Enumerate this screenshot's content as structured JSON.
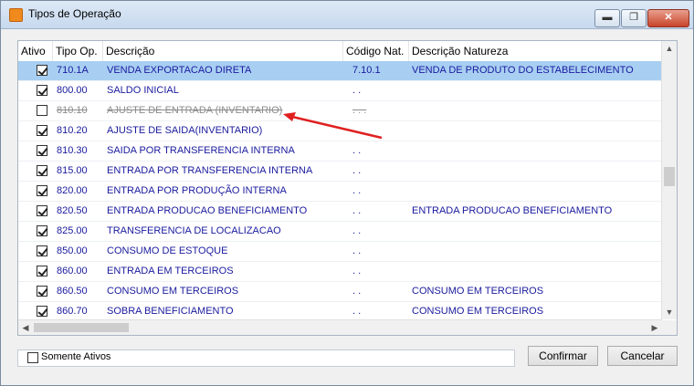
{
  "window": {
    "title": "Tipos de Operação",
    "accent": "#a8cff2",
    "text_color": "#1a1a9e",
    "annotation_color": "#e02020"
  },
  "titlebar": {
    "minimize_icon": "▬",
    "maximize_icon": "❐",
    "close_icon": "✕"
  },
  "grid": {
    "columns": [
      "Ativo",
      "Tipo Op.",
      "Descrição",
      "Código Nat.",
      "Descrição Natureza"
    ],
    "rows": [
      {
        "ativo": true,
        "tipo": "710.1A",
        "descricao": "VENDA EXPORTACAO DIRETA",
        "codigo": "7.10.1",
        "natureza": "VENDA DE PRODUTO DO ESTABELECIMENTO",
        "selected": true
      },
      {
        "ativo": true,
        "tipo": "800.00",
        "descricao": "SALDO INICIAL",
        "codigo": ". .",
        "natureza": ""
      },
      {
        "ativo": false,
        "tipo": "810.10",
        "descricao": "AJUSTE DE ENTRADA (INVENTARIO)",
        "codigo": ". . .",
        "natureza": ""
      },
      {
        "ativo": true,
        "tipo": "810.20",
        "descricao": "AJUSTE DE SAIDA(INVENTARIO)",
        "codigo": "",
        "natureza": ""
      },
      {
        "ativo": true,
        "tipo": "810.30",
        "descricao": "SAIDA POR TRANSFERENCIA INTERNA",
        "codigo": ". .",
        "natureza": ""
      },
      {
        "ativo": true,
        "tipo": "815.00",
        "descricao": "ENTRADA POR TRANSFERENCIA INTERNA",
        "codigo": ". .",
        "natureza": ""
      },
      {
        "ativo": true,
        "tipo": "820.00",
        "descricao": "ENTRADA POR PRODUÇÃO INTERNA",
        "codigo": ". .",
        "natureza": ""
      },
      {
        "ativo": true,
        "tipo": "820.50",
        "descricao": "ENTRADA PRODUCAO BENEFICIAMENTO",
        "codigo": ". .",
        "natureza": "ENTRADA PRODUCAO BENEFICIAMENTO"
      },
      {
        "ativo": true,
        "tipo": "825.00",
        "descricao": "TRANSFERENCIA DE LOCALIZACAO",
        "codigo": ". .",
        "natureza": ""
      },
      {
        "ativo": true,
        "tipo": "850.00",
        "descricao": "CONSUMO DE ESTOQUE",
        "codigo": ". .",
        "natureza": ""
      },
      {
        "ativo": true,
        "tipo": "860.00",
        "descricao": "ENTRADA EM TERCEIROS",
        "codigo": ". .",
        "natureza": ""
      },
      {
        "ativo": true,
        "tipo": "860.50",
        "descricao": "CONSUMO EM TERCEIROS",
        "codigo": ". .",
        "natureza": "CONSUMO EM TERCEIROS"
      },
      {
        "ativo": true,
        "tipo": "860.70",
        "descricao": "SOBRA BENEFICIAMENTO",
        "codigo": ". .",
        "natureza": "CONSUMO EM TERCEIROS"
      }
    ],
    "scroll_up_icon": "▲",
    "scroll_down_icon": "▼",
    "scroll_left_icon": "◀",
    "scroll_right_icon": "▶"
  },
  "footer": {
    "filter_label": "Somente Ativos",
    "confirm_label": "Confirmar",
    "cancel_label": "Cancelar"
  }
}
